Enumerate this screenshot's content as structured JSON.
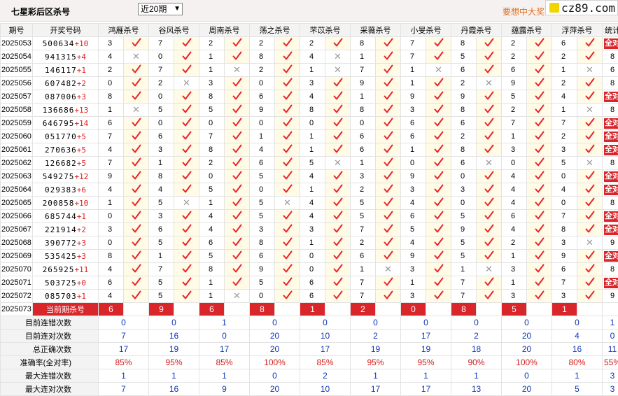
{
  "header": {
    "title": "七星彩后区杀号",
    "period_select": "近20期",
    "promo": "要想中大奖",
    "site": "cz89.com"
  },
  "columns": [
    "期号",
    "开奖号码",
    "鸿雁杀号",
    "谷风杀号",
    "周南杀号",
    "荡之杀号",
    "芣苡杀号",
    "采薇杀号",
    "小旻杀号",
    "丹霞杀号",
    "蕴露杀号",
    "浮萍杀号",
    "统计"
  ],
  "rows": [
    {
      "id": "2025053",
      "num": "500634",
      "extra": "+10",
      "kills": [
        3,
        7,
        2,
        2,
        2,
        8,
        7,
        8,
        2,
        6
      ],
      "ok": [
        1,
        1,
        1,
        1,
        1,
        1,
        1,
        1,
        1,
        1
      ],
      "stat": "全对"
    },
    {
      "id": "2025054",
      "num": "941315",
      "extra": "+4",
      "kills": [
        4,
        0,
        1,
        8,
        4,
        1,
        7,
        5,
        2,
        2
      ],
      "ok": [
        0,
        1,
        1,
        1,
        0,
        1,
        1,
        1,
        1,
        1
      ],
      "stat": "8"
    },
    {
      "id": "2025055",
      "num": "146117",
      "extra": "+1",
      "kills": [
        2,
        7,
        1,
        2,
        1,
        7,
        1,
        6,
        6,
        1
      ],
      "ok": [
        1,
        1,
        0,
        1,
        0,
        1,
        0,
        1,
        1,
        0
      ],
      "stat": "6"
    },
    {
      "id": "2025056",
      "num": "607482",
      "extra": "+2",
      "kills": [
        0,
        2,
        3,
        0,
        3,
        9,
        1,
        2,
        9,
        2
      ],
      "ok": [
        1,
        0,
        1,
        1,
        1,
        1,
        1,
        0,
        1,
        1
      ],
      "stat": "8"
    },
    {
      "id": "2025057",
      "num": "087006",
      "extra": "+3",
      "kills": [
        8,
        0,
        8,
        6,
        4,
        1,
        9,
        9,
        5,
        4
      ],
      "ok": [
        1,
        1,
        1,
        1,
        1,
        1,
        1,
        1,
        1,
        1
      ],
      "stat": "全对"
    },
    {
      "id": "2025058",
      "num": "136686",
      "extra": "+13",
      "kills": [
        1,
        5,
        5,
        9,
        8,
        8,
        3,
        8,
        2,
        1
      ],
      "ok": [
        0,
        1,
        1,
        1,
        1,
        1,
        1,
        1,
        1,
        0
      ],
      "stat": "8"
    },
    {
      "id": "2025059",
      "num": "646795",
      "extra": "+14",
      "kills": [
        6,
        0,
        0,
        0,
        0,
        0,
        6,
        6,
        7,
        7
      ],
      "ok": [
        1,
        1,
        1,
        1,
        1,
        1,
        1,
        1,
        1,
        1
      ],
      "stat": "全对"
    },
    {
      "id": "2025060",
      "num": "051770",
      "extra": "+5",
      "kills": [
        7,
        6,
        7,
        1,
        1,
        6,
        6,
        2,
        1,
        2
      ],
      "ok": [
        1,
        1,
        1,
        1,
        1,
        1,
        1,
        1,
        1,
        1
      ],
      "stat": "全对"
    },
    {
      "id": "2025061",
      "num": "270636",
      "extra": "+5",
      "kills": [
        4,
        3,
        8,
        4,
        1,
        6,
        1,
        8,
        3,
        3
      ],
      "ok": [
        1,
        1,
        1,
        1,
        1,
        1,
        1,
        1,
        1,
        1
      ],
      "stat": "全对"
    },
    {
      "id": "2025062",
      "num": "126682",
      "extra": "+5",
      "kills": [
        7,
        1,
        2,
        6,
        5,
        1,
        0,
        6,
        0,
        5
      ],
      "ok": [
        1,
        1,
        1,
        1,
        0,
        1,
        1,
        0,
        1,
        0
      ],
      "stat": "8"
    },
    {
      "id": "2025063",
      "num": "549275",
      "extra": "+12",
      "kills": [
        9,
        8,
        0,
        5,
        4,
        3,
        9,
        0,
        4,
        0
      ],
      "ok": [
        1,
        1,
        1,
        1,
        1,
        1,
        1,
        1,
        1,
        1
      ],
      "stat": "全对"
    },
    {
      "id": "2025064",
      "num": "029383",
      "extra": "+6",
      "kills": [
        4,
        4,
        5,
        0,
        1,
        2,
        3,
        3,
        4,
        4
      ],
      "ok": [
        1,
        1,
        1,
        1,
        1,
        1,
        1,
        1,
        1,
        1
      ],
      "stat": "全对"
    },
    {
      "id": "2025065",
      "num": "200858",
      "extra": "+10",
      "kills": [
        1,
        5,
        1,
        5,
        4,
        5,
        4,
        0,
        4,
        0
      ],
      "ok": [
        1,
        0,
        1,
        0,
        1,
        1,
        1,
        1,
        1,
        1
      ],
      "stat": "8"
    },
    {
      "id": "2025066",
      "num": "685744",
      "extra": "+1",
      "kills": [
        0,
        3,
        4,
        5,
        4,
        5,
        6,
        5,
        6,
        7
      ],
      "ok": [
        1,
        1,
        1,
        1,
        1,
        1,
        1,
        1,
        1,
        1
      ],
      "stat": "全对"
    },
    {
      "id": "2025067",
      "num": "221914",
      "extra": "+2",
      "kills": [
        3,
        6,
        4,
        3,
        3,
        7,
        5,
        9,
        4,
        8
      ],
      "ok": [
        1,
        1,
        1,
        1,
        1,
        1,
        1,
        1,
        1,
        1
      ],
      "stat": "全对"
    },
    {
      "id": "2025068",
      "num": "390772",
      "extra": "+3",
      "kills": [
        0,
        5,
        6,
        8,
        1,
        2,
        4,
        5,
        2,
        3
      ],
      "ok": [
        1,
        1,
        1,
        1,
        1,
        1,
        1,
        1,
        1,
        0
      ],
      "stat": "9"
    },
    {
      "id": "2025069",
      "num": "535425",
      "extra": "+3",
      "kills": [
        8,
        1,
        5,
        6,
        0,
        6,
        9,
        5,
        1,
        9
      ],
      "ok": [
        1,
        1,
        1,
        1,
        1,
        1,
        1,
        1,
        1,
        1
      ],
      "stat": "全对"
    },
    {
      "id": "2025070",
      "num": "265925",
      "extra": "+11",
      "kills": [
        4,
        7,
        8,
        9,
        0,
        1,
        3,
        1,
        3,
        6
      ],
      "ok": [
        1,
        1,
        1,
        1,
        1,
        0,
        1,
        0,
        1,
        1
      ],
      "stat": "8"
    },
    {
      "id": "2025071",
      "num": "503725",
      "extra": "+0",
      "kills": [
        6,
        5,
        1,
        5,
        6,
        7,
        1,
        7,
        1,
        7
      ],
      "ok": [
        1,
        1,
        1,
        1,
        1,
        1,
        1,
        1,
        1,
        1
      ],
      "stat": "全对"
    },
    {
      "id": "2025072",
      "num": "085703",
      "extra": "+1",
      "kills": [
        4,
        5,
        1,
        0,
        6,
        7,
        3,
        7,
        3,
        3
      ],
      "ok": [
        1,
        1,
        0,
        1,
        1,
        1,
        1,
        1,
        1,
        1
      ],
      "stat": "9"
    }
  ],
  "current": {
    "id": "2025073",
    "label": "当前期杀号",
    "kills": [
      6,
      9,
      6,
      8,
      1,
      2,
      0,
      8,
      5,
      1
    ]
  },
  "summary": [
    {
      "label": "目前连错次数",
      "values": [
        "0",
        "0",
        "1",
        "0",
        "0",
        "0",
        "0",
        "0",
        "0",
        "0",
        "1"
      ],
      "red": false
    },
    {
      "label": "目前连对次数",
      "values": [
        "7",
        "16",
        "0",
        "20",
        "10",
        "2",
        "17",
        "2",
        "20",
        "4",
        "0"
      ],
      "red": false
    },
    {
      "label": "总正确次数",
      "values": [
        "17",
        "19",
        "17",
        "20",
        "17",
        "19",
        "19",
        "18",
        "20",
        "16",
        "11"
      ],
      "red": false
    },
    {
      "label": "准确率(全对率)",
      "values": [
        "85%",
        "95%",
        "85%",
        "100%",
        "85%",
        "95%",
        "95%",
        "90%",
        "100%",
        "80%",
        "55%"
      ],
      "red": true
    },
    {
      "label": "最大连错次数",
      "values": [
        "1",
        "1",
        "1",
        "0",
        "2",
        "1",
        "1",
        "1",
        "0",
        "1",
        "3"
      ],
      "red": false
    },
    {
      "label": "最大连对次数",
      "values": [
        "7",
        "16",
        "9",
        "20",
        "10",
        "17",
        "17",
        "13",
        "20",
        "5",
        "3"
      ],
      "red": false
    }
  ]
}
